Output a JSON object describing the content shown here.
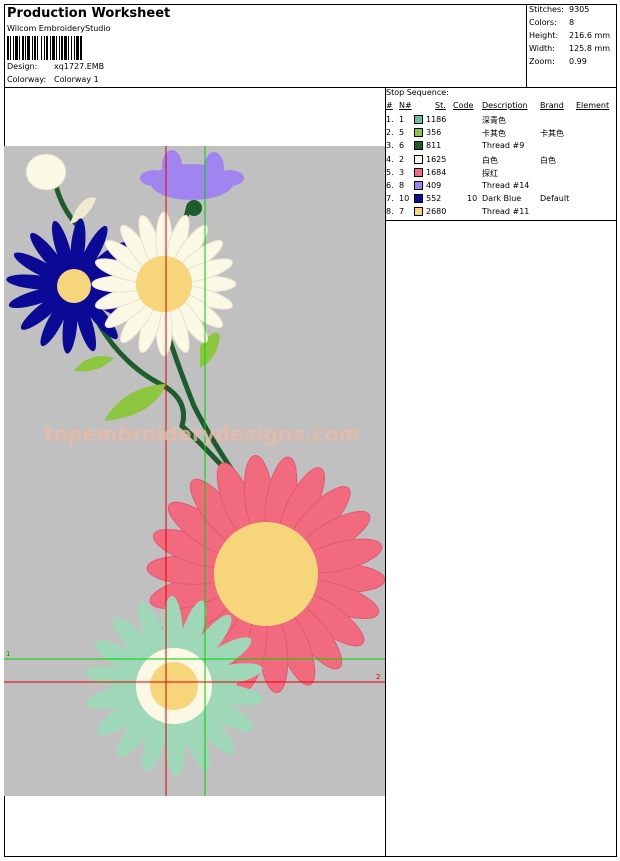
{
  "header": {
    "title": "Production Worksheet",
    "software": "Wilcom EmbroideryStudio",
    "design_label": "Design:",
    "design_value": "xq1727.EMB",
    "colorway_label": "Colorway:",
    "colorway_value": "Colorway 1"
  },
  "stats": [
    {
      "label": "Stitches:",
      "value": "9305"
    },
    {
      "label": "Colors:",
      "value": "8"
    },
    {
      "label": "Height:",
      "value": "216.6 mm"
    },
    {
      "label": "Width:",
      "value": "125.8 mm"
    },
    {
      "label": "Zoom:",
      "value": "0.99"
    }
  ],
  "stop_sequence": {
    "title": "Stop Sequence:",
    "headers": {
      "idx": "#",
      "n": "N#",
      "st": "St.",
      "code": "Code",
      "description": "Description",
      "brand": "Brand",
      "element": "Element"
    },
    "rows": [
      {
        "idx": "1.",
        "n": "1",
        "color": "#66c29a",
        "st": "1186",
        "code": "",
        "description": "深青色",
        "brand": "",
        "element": ""
      },
      {
        "idx": "2.",
        "n": "5",
        "color": "#8dc63f",
        "st": "356",
        "code": "",
        "description": "卡其色",
        "brand": "卡其色",
        "element": ""
      },
      {
        "idx": "3.",
        "n": "6",
        "color": "#1d5c2c",
        "st": "811",
        "code": "",
        "description": "Thread #9",
        "brand": "",
        "element": ""
      },
      {
        "idx": "4.",
        "n": "2",
        "color": "#fbf8e6",
        "st": "1625",
        "code": "",
        "description": "白色",
        "brand": "白色",
        "element": ""
      },
      {
        "idx": "5.",
        "n": "3",
        "color": "#f16a7e",
        "st": "1684",
        "code": "",
        "description": "探红",
        "brand": "",
        "element": ""
      },
      {
        "idx": "6.",
        "n": "8",
        "color": "#a184f0",
        "st": "409",
        "code": "",
        "description": "Thread #14",
        "brand": "",
        "element": ""
      },
      {
        "idx": "7.",
        "n": "10",
        "color": "#0a0a96",
        "st": "552",
        "code": "10",
        "description": "Dark Blue",
        "brand": "Default",
        "element": ""
      },
      {
        "idx": "8.",
        "n": "7",
        "color": "#f7d57a",
        "st": "2680",
        "code": "",
        "description": "Thread #11",
        "brand": "",
        "element": ""
      }
    ]
  },
  "canvas": {
    "watermark": "topembroiderydesigns.com",
    "marker_1": "1",
    "marker_2": "2"
  },
  "colors": {
    "design_bg": "#c0c0c0",
    "guide_red": "#e00000",
    "guide_green": "#00d000"
  }
}
